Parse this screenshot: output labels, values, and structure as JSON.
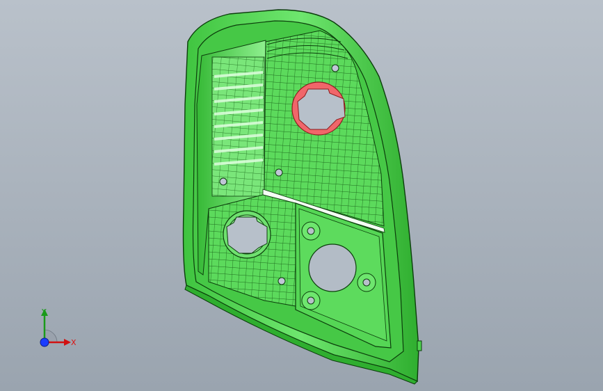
{
  "scene": {
    "description_text": "",
    "background_top": "#b9c1ca",
    "background_bottom": "#9aa4af",
    "part_color": "#4fd24f",
    "part_edge": "#0b3d0b",
    "highlight_color": "#f0666a"
  },
  "triad": {
    "y_label": "Y",
    "x_label": "X",
    "y_color": "#1a9a1a",
    "x_color": "#d11111",
    "z_color": "#1a3cff"
  }
}
